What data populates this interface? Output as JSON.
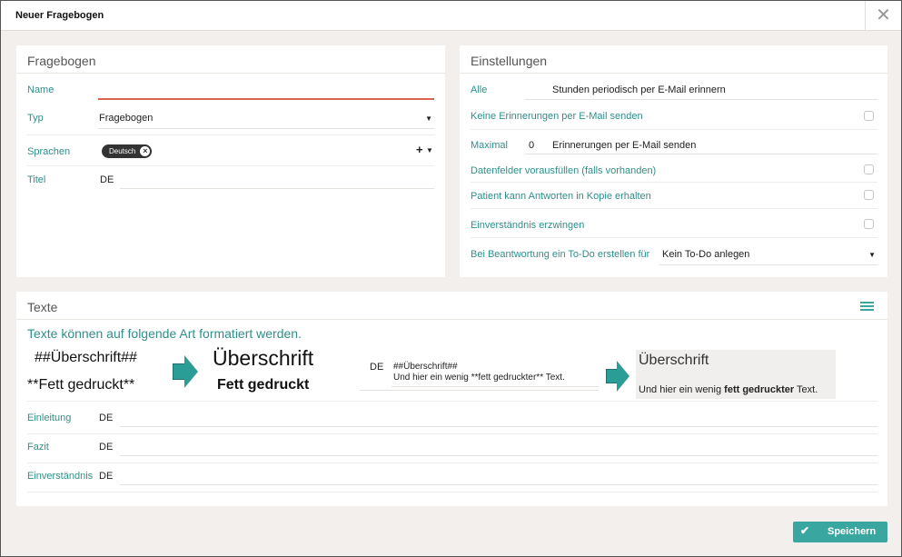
{
  "dialog": {
    "title": "Neuer Fragebogen",
    "close_glyph": "✕"
  },
  "fragebogen": {
    "title": "Fragebogen",
    "name_label": "Name",
    "name_value": "",
    "typ_label": "Typ",
    "typ_value": "Fragebogen",
    "sprachen_label": "Sprachen",
    "sprachen_chip": "Deutsch",
    "sprachen_add": "+",
    "titel_label": "Titel",
    "titel_lang": "DE"
  },
  "einstellungen": {
    "title": "Einstellungen",
    "alle_label": "Alle",
    "alle_value": "Stunden periodisch per E-Mail erinnern",
    "keine_label": "Keine Erinnerungen per E-Mail senden",
    "maximal_label": "Maximal",
    "maximal_number": "0",
    "maximal_value": "Erinnerungen per E-Mail senden",
    "datenfelder_label": "Datenfelder vorausfüllen (falls vorhanden)",
    "kopie_label": "Patient kann Antworten in Kopie erhalten",
    "einverstaendnis_label": "Einverständnis erzwingen",
    "todo_label": "Bei Beantwortung ein To-Do erstellen für",
    "todo_value": "Kein To-Do anlegen"
  },
  "texte": {
    "title": "Texte",
    "format_hint": "Texte können auf folgende Art formatiert werden.",
    "md_heading": "##Überschrift##",
    "md_bold": "**Fett gedruckt**",
    "rendered_heading": "Überschrift",
    "rendered_bold": "Fett gedruckt",
    "example_lang": "DE",
    "example_line1": "##Überschrift##",
    "example_line2": "Und hier ein wenig **fett gedruckter** Text.",
    "preview_heading": "Überschrift",
    "preview_prefix": "Und hier ein wenig ",
    "preview_bold": "fett gedruckter",
    "preview_suffix": " Text.",
    "einleitung_label": "Einleitung",
    "einleitung_lang": "DE",
    "fazit_label": "Fazit",
    "fazit_lang": "DE",
    "einverstaendnis_label": "Einverständnis",
    "einverstaendnis_lang": "DE"
  },
  "footer": {
    "save_label": "Speichern"
  },
  "colors": {
    "accent": "#3aa6a0",
    "label": "#2f8f8a",
    "error_line": "#d9634f"
  }
}
